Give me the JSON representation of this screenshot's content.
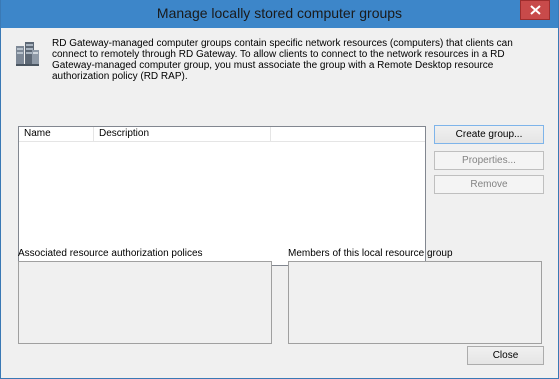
{
  "window": {
    "title": "Manage locally stored computer groups",
    "close_icon": "close-icon",
    "titlebar_color": "#3d86c9",
    "close_color": "#c84a4a"
  },
  "info": {
    "icon": "server-group-icon",
    "text": "RD Gateway-managed computer groups contain specific network resources (computers) that clients can connect to remotely through RD Gateway. To allow clients to connect to the network resources in a RD Gateway-managed computer group, you must associate the group with a Remote Desktop resource authorization policy (RD RAP)."
  },
  "groups_list": {
    "columns": [
      "Name",
      "Description",
      ""
    ],
    "rows": []
  },
  "buttons": {
    "create": "Create group...",
    "properties": "Properties...",
    "remove": "Remove",
    "close": "Close"
  },
  "sections": {
    "policies_label": "Associated resource authorization polices",
    "members_label": "Members of this local resource group"
  }
}
